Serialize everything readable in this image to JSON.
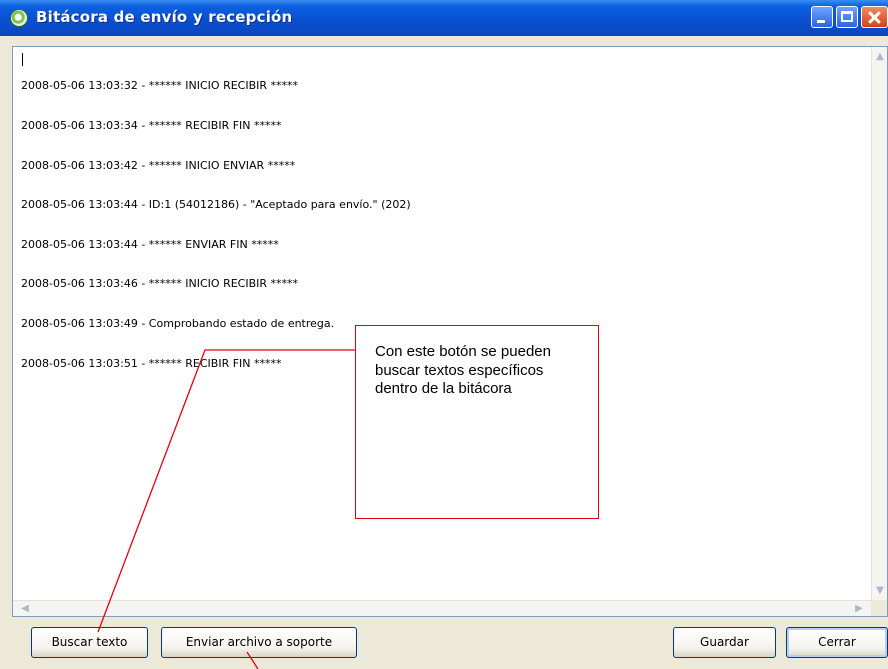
{
  "window": {
    "title": "Bitácora de envío y recepción",
    "titlebar_color": "#0b5fe0",
    "controls": [
      "minimize-icon",
      "maximize-icon",
      "close-icon"
    ]
  },
  "log": {
    "lines": [
      "2008-05-06 13:03:32 - ****** INICIO RECIBIR *****",
      "2008-05-06 13:03:34 - ****** RECIBIR FIN *****",
      "2008-05-06 13:03:42 - ****** INICIO ENVIAR *****",
      "2008-05-06 13:03:44 - ID:1 (54012186) - \"Aceptado para envío.\" (202)",
      "2008-05-06 13:03:44 - ****** ENVIAR FIN *****",
      "2008-05-06 13:03:46 - ****** INICIO RECIBIR *****",
      "2008-05-06 13:03:49 - Comprobando estado de entrega.",
      "2008-05-06 13:03:51 - ****** RECIBIR FIN *****"
    ]
  },
  "buttons": {
    "search": "Buscar texto",
    "send_support": "Enviar archivo a soporte",
    "save": "Guardar",
    "close": "Cerrar"
  },
  "annotation": {
    "text": "Con este botón se pueden buscar textos específicos dentro de la bitácora",
    "color": "#e3000f"
  }
}
